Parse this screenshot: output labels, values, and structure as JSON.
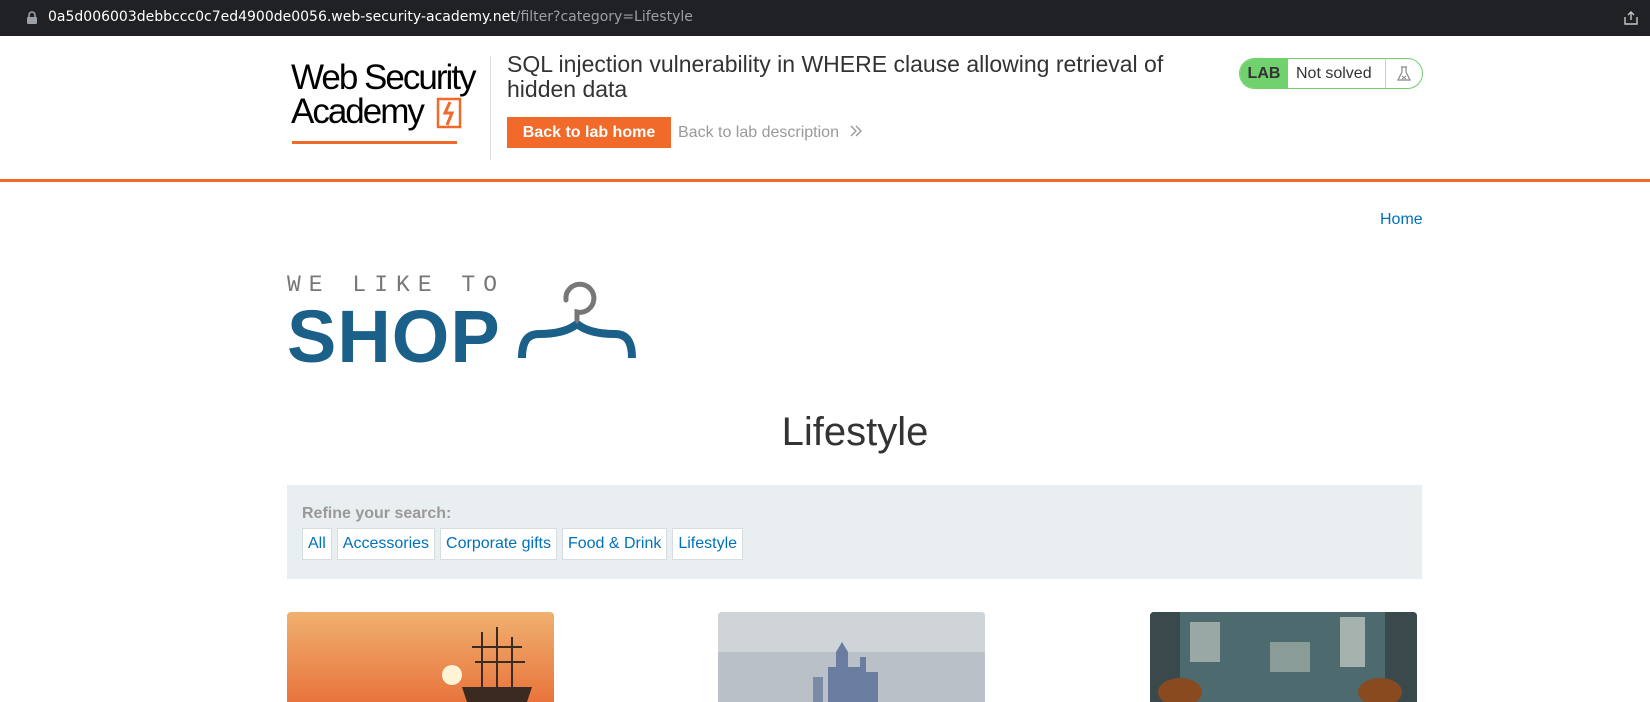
{
  "browser": {
    "url_host": "0a5d006003debbccc0c7ed4900de0056.web-security-academy.net",
    "url_path": "/filter?category=Lifestyle"
  },
  "lab_header": {
    "logo_line1": "Web Security",
    "logo_line2": "Academy",
    "title": "SQL injection vulnerability in WHERE clause allowing retrieval of hidden data",
    "back_home_label": "Back to lab home",
    "back_description_label": "Back to lab description",
    "status_tag": "LAB",
    "status_text": "Not solved"
  },
  "shop": {
    "nav_home": "Home",
    "logo_top": "WE LIKE TO",
    "logo_main": "SHOP",
    "page_title": "Lifestyle",
    "filter_label": "Refine your search:",
    "filters": [
      "All",
      "Accessories",
      "Corporate gifts",
      "Food & Drink",
      "Lifestyle"
    ]
  },
  "colors": {
    "accent": "#f26a29",
    "link": "#0071bc",
    "lab_green": "#70d16d",
    "shop_blue": "#1a6089"
  },
  "icons": {
    "lock": "lock-icon",
    "share": "share-icon",
    "flask": "flask-icon",
    "chevrons": "double-chevron-right-icon",
    "hanger": "hanger-icon"
  }
}
